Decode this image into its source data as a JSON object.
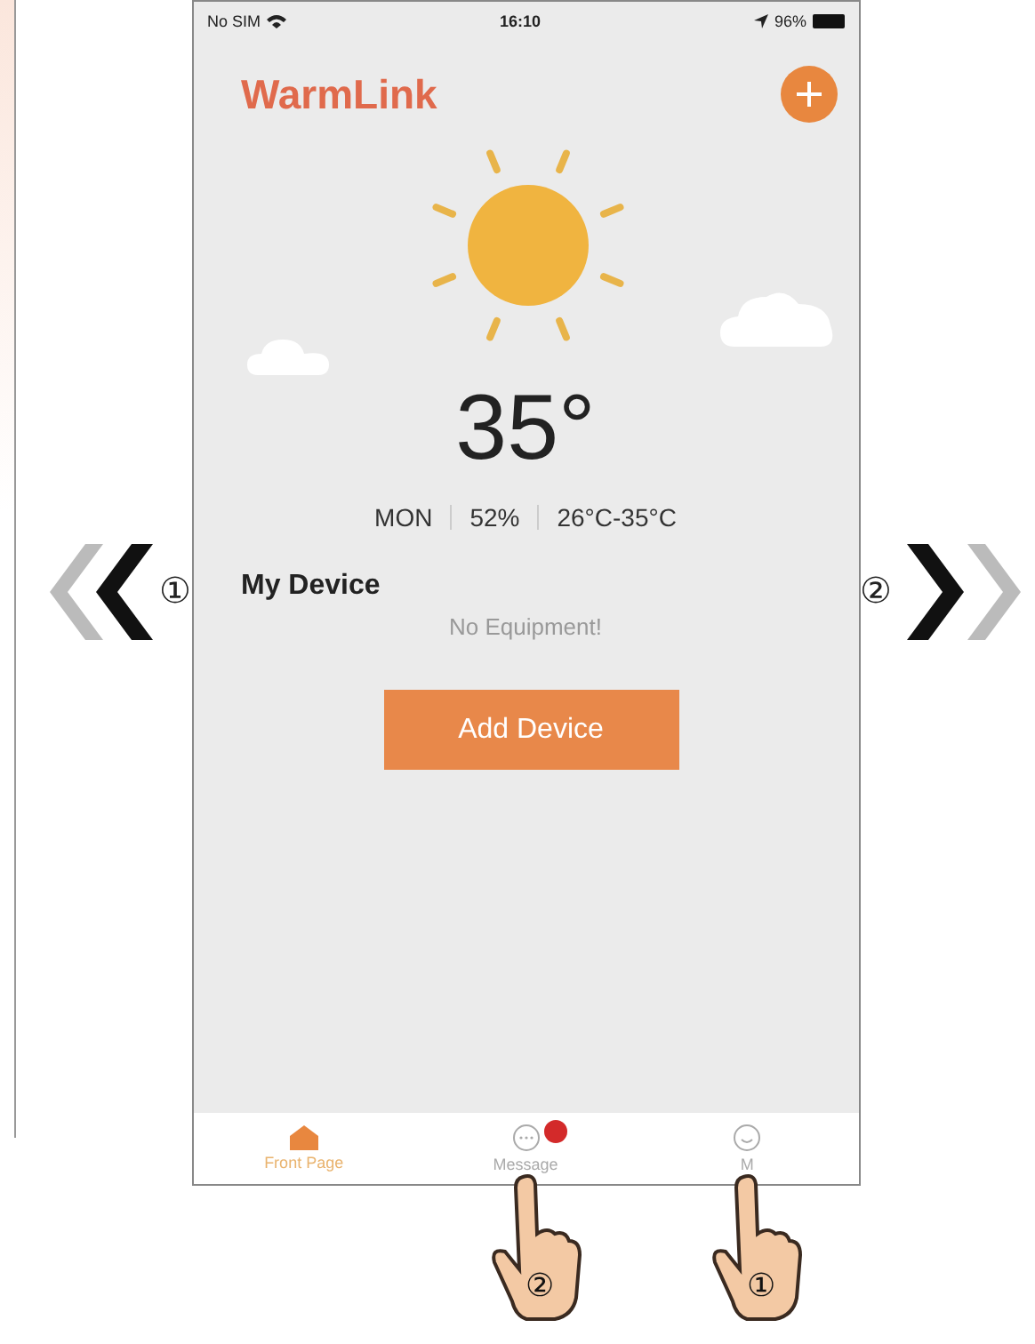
{
  "status_bar": {
    "carrier": "No SIM",
    "time": "16:10",
    "battery": "96%"
  },
  "app_title": "WarmLink",
  "weather": {
    "temperature": "35°",
    "day": "MON",
    "humidity": "52%",
    "range": "26°C-35°C"
  },
  "section_title": "My Device",
  "empty_message": "No Equipment!",
  "add_button": "Add Device",
  "tabs": [
    {
      "label": "Front Page",
      "selected": true,
      "kind": "home",
      "badge": false
    },
    {
      "label": "Message",
      "selected": false,
      "kind": "chat",
      "badge": true,
      "callout": "②"
    },
    {
      "label": "M",
      "selected": false,
      "kind": "smile",
      "badge": false,
      "callout": "①"
    }
  ],
  "nav": {
    "prev_step": "①",
    "next_step": "②"
  }
}
